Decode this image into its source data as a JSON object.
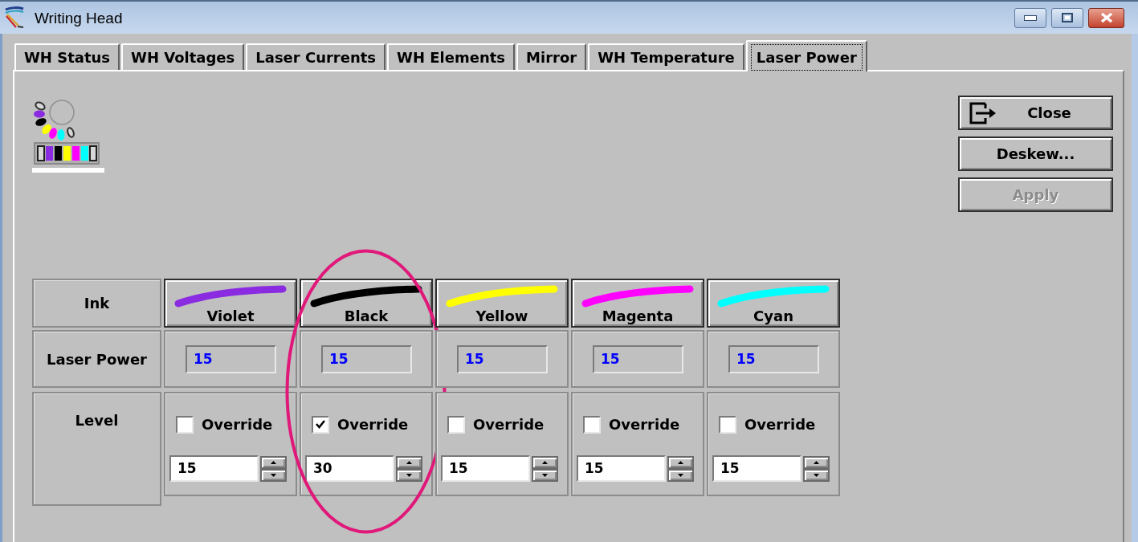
{
  "window": {
    "title": "Writing Head"
  },
  "tabs": [
    {
      "label": "WH Status",
      "selected": false
    },
    {
      "label": "WH Voltages",
      "selected": false
    },
    {
      "label": "Laser Currents",
      "selected": false
    },
    {
      "label": "WH Elements",
      "selected": false
    },
    {
      "label": "Mirror",
      "selected": false
    },
    {
      "label": "WH Temperature",
      "selected": false
    },
    {
      "label": "Laser Power",
      "selected": true
    }
  ],
  "buttons": [
    {
      "label": "Close",
      "icon": true,
      "disabled": false
    },
    {
      "label": "Deskew...",
      "icon": false,
      "disabled": false
    },
    {
      "label": "Apply",
      "icon": false,
      "disabled": true
    }
  ],
  "grid": {
    "row_labels": [
      "Ink",
      "Laser Power",
      "Level"
    ],
    "inks": [
      {
        "name": "Violet",
        "color": "#8a2be2",
        "laser_power": "15",
        "override_label": "Override",
        "override": false,
        "level_input": "15",
        "highlighted": false
      },
      {
        "name": "Black",
        "color": "#000000",
        "laser_power": "15",
        "override_label": "Override",
        "override": true,
        "level_input": "30",
        "highlighted": true
      },
      {
        "name": "Yellow",
        "color": "#ffff00",
        "laser_power": "15",
        "override_label": "Override",
        "override": false,
        "level_input": "15",
        "highlighted": false
      },
      {
        "name": "Magenta",
        "color": "#ff00ff",
        "laser_power": "15",
        "override_label": "Override",
        "override": false,
        "level_input": "15",
        "highlighted": false
      },
      {
        "name": "Cyan",
        "color": "#00ffff",
        "laser_power": "15",
        "override_label": "Override",
        "override": false,
        "level_input": "15",
        "highlighted": false
      }
    ]
  }
}
